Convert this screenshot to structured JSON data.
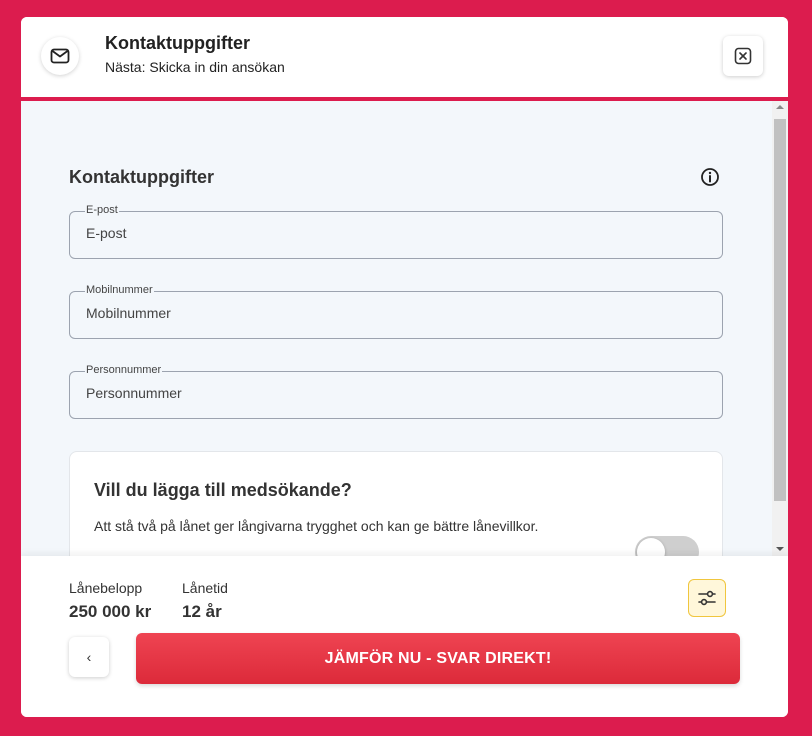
{
  "colors": {
    "background": "#dc1c4e",
    "accent": "#dc1c4e",
    "cta": "#e63946",
    "form_bg": "#f3f7fb",
    "adjust_button_bg": "#fff7da"
  },
  "header": {
    "icon": "envelope-icon",
    "title": "Kontaktuppgifter",
    "subtitle": "Nästa: Skicka in din ansökan",
    "close_icon": "close-icon"
  },
  "form": {
    "section_title": "Kontaktuppgifter",
    "info_icon": "info-icon",
    "fields": [
      {
        "label": "E-post",
        "placeholder": "E-post",
        "value": ""
      },
      {
        "label": "Mobilnummer",
        "placeholder": "Mobilnummer",
        "value": ""
      },
      {
        "label": "Personnummer",
        "placeholder": "Personnummer",
        "value": ""
      }
    ],
    "co_applicant": {
      "title": "Vill du lägga till medsökande?",
      "description": "Att stå två på lånet ger långivarna trygghet och kan ge bättre lånevillkor.",
      "toggle_on": false
    }
  },
  "footer": {
    "loan_amount_label": "Lånebelopp",
    "loan_amount_value": "250 000 kr",
    "loan_term_label": "Lånetid",
    "loan_term_value": "12 år",
    "adjust_icon": "sliders-icon",
    "back_label": "‹",
    "cta_label": "JÄMFÖR NU - SVAR DIREKT!"
  }
}
